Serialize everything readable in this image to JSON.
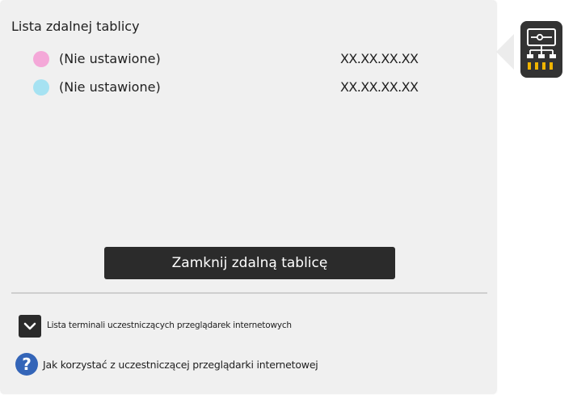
{
  "panel": {
    "title": "Lista zdalnej tablicy",
    "entries": [
      {
        "name": "(Nie ustawione)",
        "address": "XX.XX.XX.XX",
        "color": "#f4a8d8"
      },
      {
        "name": "(Nie ustawione)",
        "address": "XX.XX.XX.XX",
        "color": "#a6e2f2"
      }
    ],
    "close_button_label": "Zamknij zdalną tablicę"
  },
  "footer": {
    "expand_label": "Lista terminali uczestniczących przeglądarek internetowych",
    "expand_icon": "chevron-down-icon",
    "help_label": "Jak korzystać z uczestniczącej przeglądarki internetowej",
    "help_glyph": "?",
    "help_icon": "help-icon"
  },
  "side": {
    "icon": "network-board-icon",
    "accent": "#f0b400"
  }
}
